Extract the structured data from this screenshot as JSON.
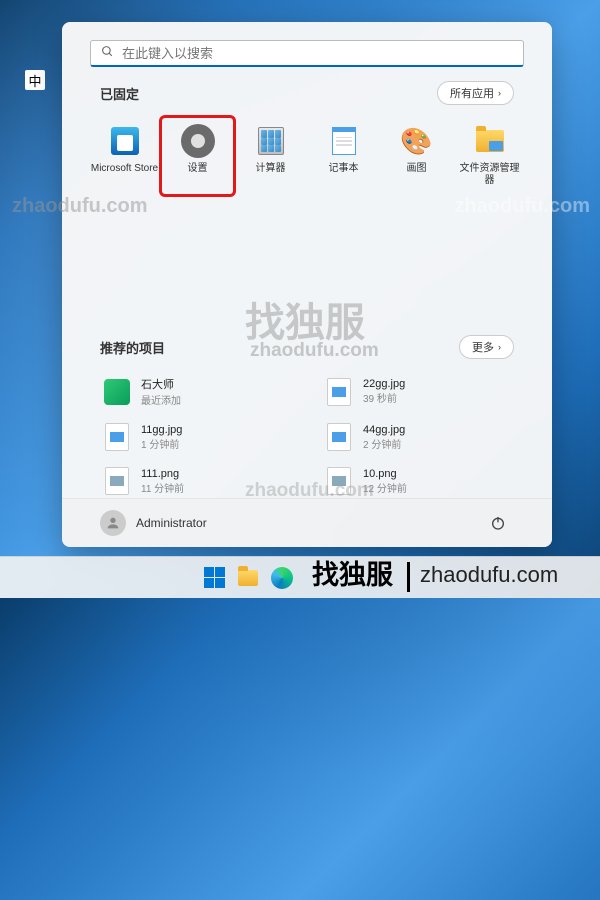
{
  "ime": {
    "indicator": "中"
  },
  "search": {
    "placeholder": "在此键入以搜索"
  },
  "pinned": {
    "title": "已固定",
    "button": "所有应用",
    "items": [
      {
        "label": "Microsoft Store"
      },
      {
        "label": "设置"
      },
      {
        "label": "计算器"
      },
      {
        "label": "记事本"
      },
      {
        "label": "画图"
      },
      {
        "label": "文件资源管理器"
      }
    ]
  },
  "recommended": {
    "title": "推荐的项目",
    "button": "更多",
    "items": [
      {
        "name": "石大师",
        "sub": "最近添加"
      },
      {
        "name": "22gg.jpg",
        "sub": "39 秒前"
      },
      {
        "name": "11gg.jpg",
        "sub": "1 分钟前"
      },
      {
        "name": "44gg.jpg",
        "sub": "2 分钟前"
      },
      {
        "name": "111.png",
        "sub": "11 分钟前"
      },
      {
        "name": "10.png",
        "sub": "12 分钟前"
      }
    ]
  },
  "user": {
    "name": "Administrator"
  },
  "watermarks": {
    "url": "zhaodufu.com",
    "big": "找独服",
    "footer_cn": "找独服",
    "footer_url": "zhaodufu.com"
  }
}
